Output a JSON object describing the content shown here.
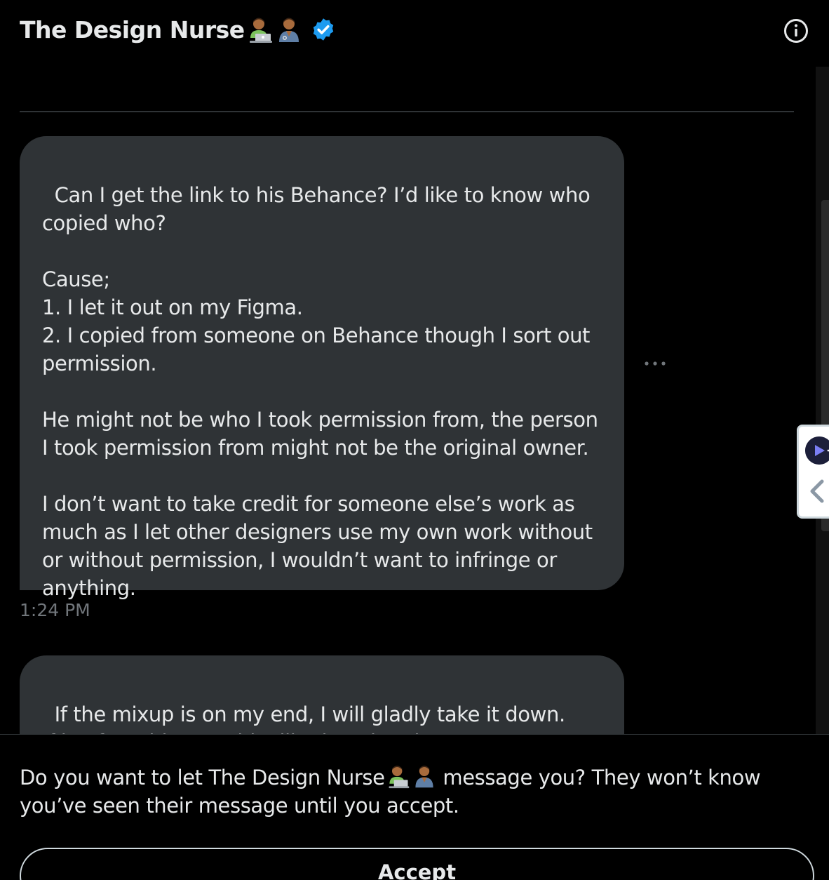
{
  "header": {
    "title": "The Design Nurse",
    "emojis": [
      "technologist-emoji",
      "health-worker-emoji"
    ],
    "verified_color": "#1d9bf0"
  },
  "messages": [
    {
      "text": "Can I get the link to his Behance? I’d like to know who copied who?\n\nCause;\n1. I let it out on my Figma.\n2. I copied from someone on Behance though I sort out permission.\n\nHe might not be who I took permission from, the person I took permission from might not be the original owner.\n\nI don’t want to take credit for someone else’s work as much as I let other designers use my own work without or without permission, I wouldn’t want to infringe or anything.",
      "time": "1:24 PM"
    },
    {
      "text": "If the mixup is on my end, I will gladly take it down.\nIf it’s from his, I could still take mine down. For me,"
    }
  ],
  "footer": {
    "prompt_before": "Do you want to let The Design Nurse",
    "prompt_after": " message you? They won’t know you’ve seen their message until you accept.",
    "accept_label": "Accept"
  },
  "colors": {
    "background": "#000000",
    "bubble": "#2f3336",
    "text": "#e7e9ea",
    "muted": "#71767b"
  }
}
